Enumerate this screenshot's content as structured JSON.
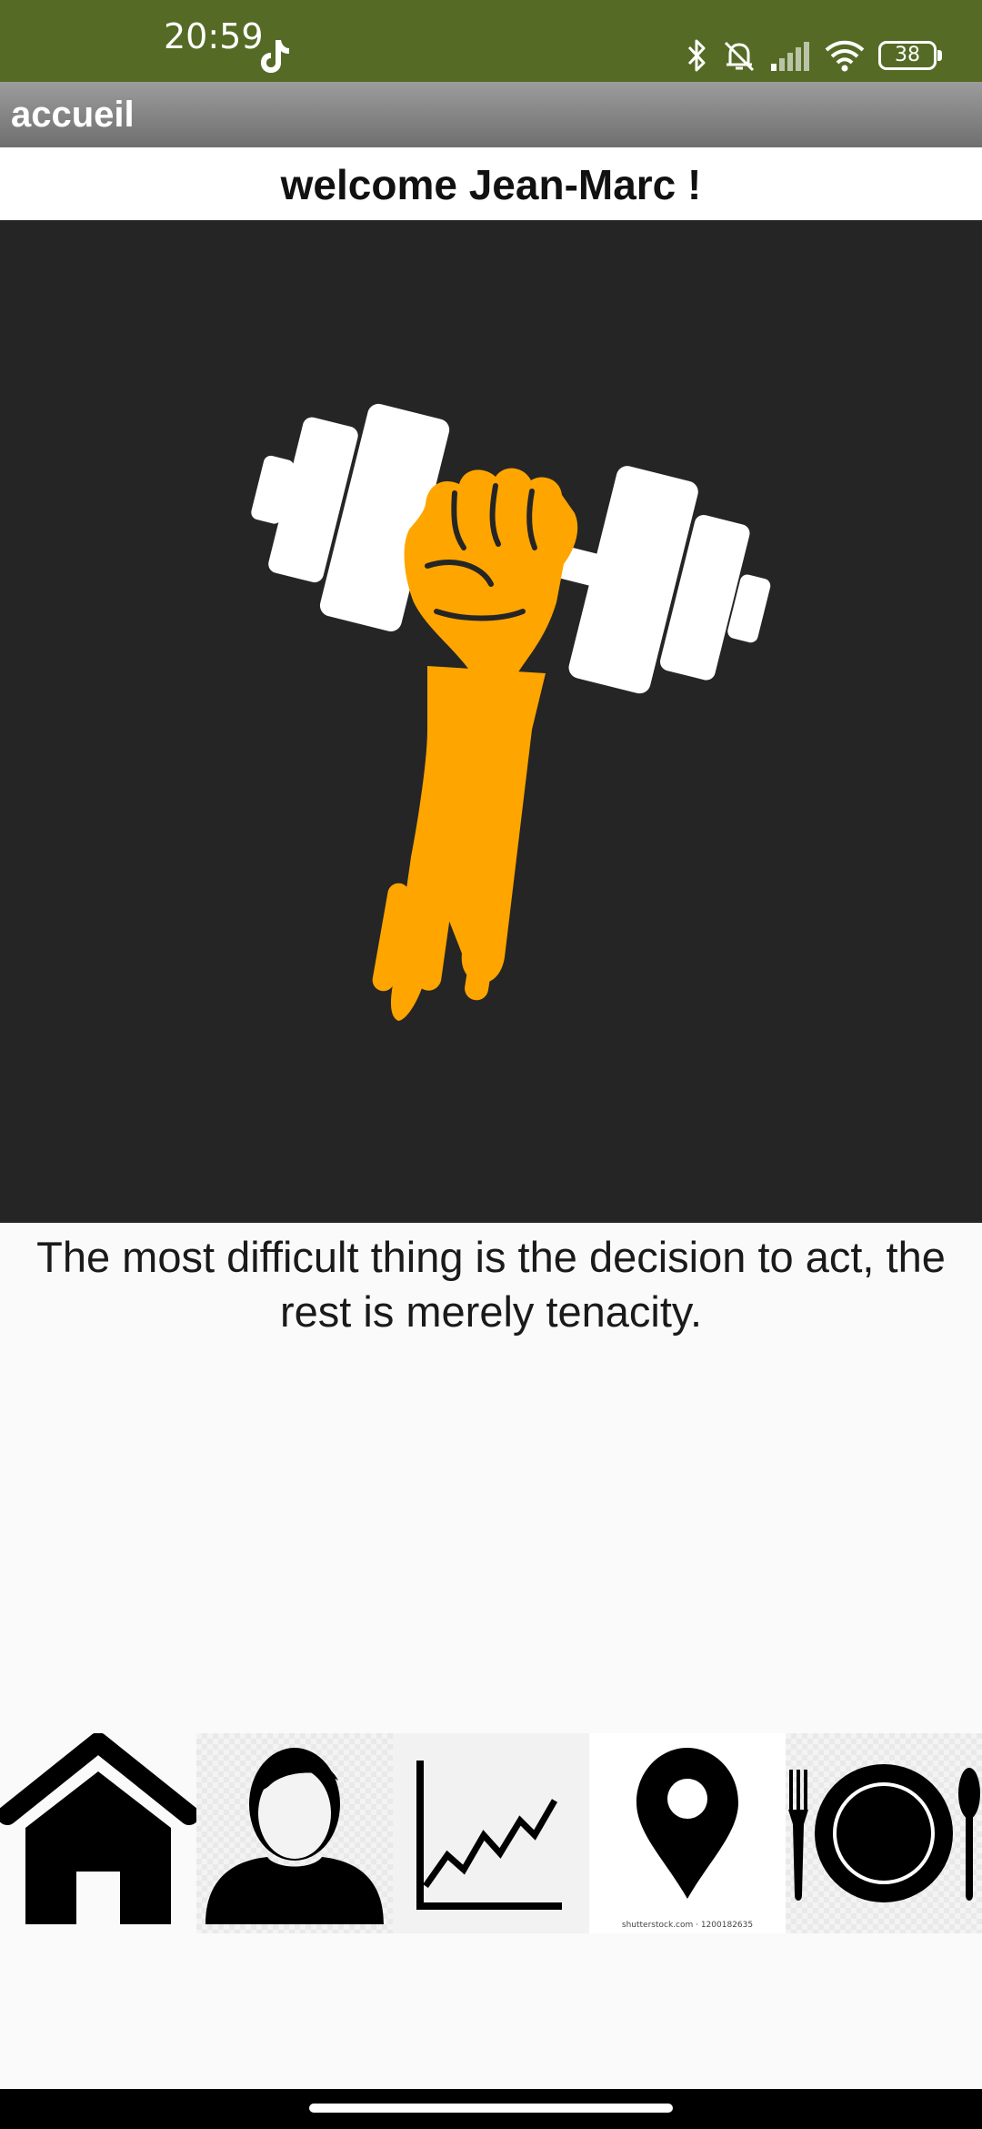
{
  "status_bar": {
    "time": "20:59",
    "battery": "38",
    "icons": [
      "tiktok-icon",
      "bluetooth-icon",
      "bell-off-icon",
      "signal-icon",
      "wifi-icon",
      "battery-icon"
    ]
  },
  "app_bar": {
    "title": "accueil"
  },
  "welcome": {
    "text": "welcome Jean-Marc !"
  },
  "hero": {
    "icon": "dumbbell-fist-icon",
    "colors": {
      "background": "#252525",
      "fist": "#FFA500",
      "weights": "#FFFFFF"
    }
  },
  "quote": {
    "text": "The most difficult thing is the decision to act, the rest is merely tenacity."
  },
  "bottom_nav": {
    "items": [
      {
        "icon": "home-icon"
      },
      {
        "icon": "profile-icon"
      },
      {
        "icon": "stats-chart-icon"
      },
      {
        "icon": "location-pin-icon",
        "caption": "shutterstock.com · 1200182635"
      },
      {
        "icon": "plate-cutlery-icon"
      }
    ]
  },
  "colors": {
    "status_bar": "#556B25",
    "app_bar": "#8A8A8A",
    "page": "#FAFAFA"
  }
}
